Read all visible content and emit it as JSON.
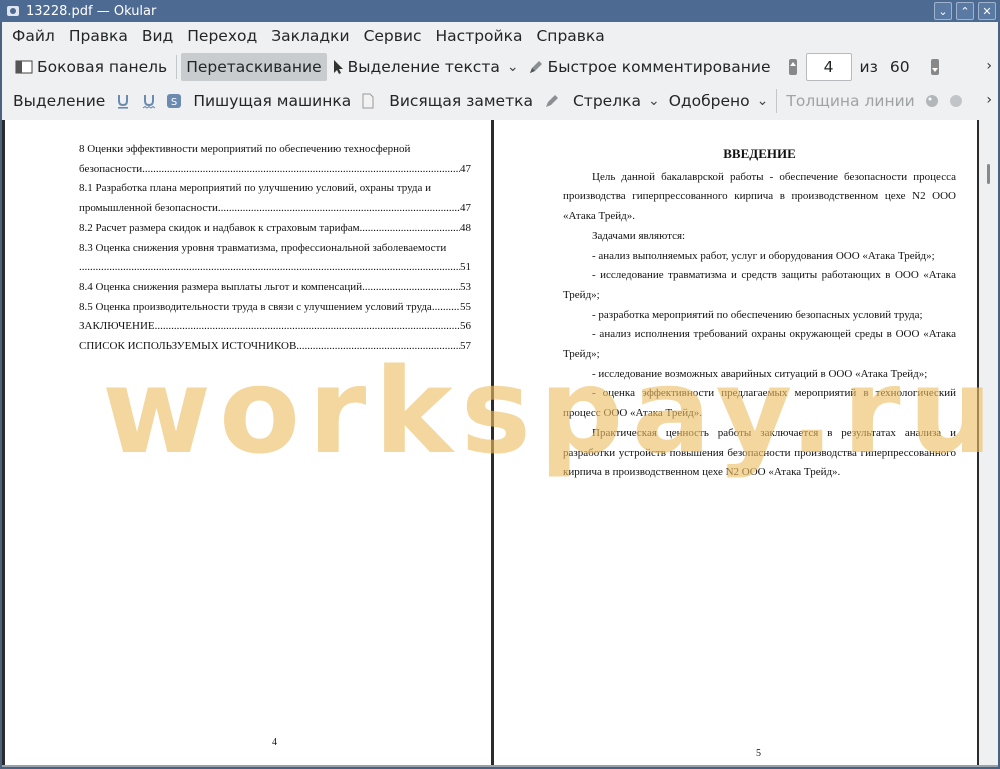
{
  "window": {
    "title": "13228.pdf — Okular",
    "controls": {
      "minimize": "⌄",
      "maximize": "⌃",
      "close": "✕"
    }
  },
  "menu": [
    "Файл",
    "Правка",
    "Вид",
    "Переход",
    "Закладки",
    "Сервис",
    "Настройка",
    "Справка"
  ],
  "toolbar1": {
    "sidebar_label": "Боковая панель",
    "drag_label": "Перетаскивание",
    "text_select_label": "Выделение текста",
    "quick_comment_label": "Быстрое комментирование",
    "page_current": "4",
    "page_of": "из",
    "page_total": "60"
  },
  "toolbar2": {
    "highlight_label": "Выделение",
    "typewriter_label": "Пишущая машинка",
    "popup_note_label": "Висящая заметка",
    "arrow_label": "Стрелка",
    "stamp_label": "Одобрено",
    "line_width_label": "Толщина линии"
  },
  "left_page": {
    "toc": [
      {
        "text": "8 Оценки эффективности мероприятий по обеспечению техносферной",
        "num": ""
      },
      {
        "text": "безопасности",
        "num": "47"
      },
      {
        "text": "8.1 Разработка плана мероприятий по улучшению условий, охраны труда и",
        "num": ""
      },
      {
        "text": "промышленной безопасности",
        "num": "47"
      },
      {
        "text": "8.2 Расчет размера скидок и надбавок к страховым тарифам",
        "num": "48"
      },
      {
        "text": "8.3 Оценка снижения уровня травматизма, профессиональной заболеваемости",
        "num": ""
      },
      {
        "text": "",
        "num": "51"
      },
      {
        "text": "8.4 Оценка снижения размера выплаты льгот и компенсаций",
        "num": "53"
      },
      {
        "text": "8.5 Оценка производительности труда в связи с улучшением условий труда",
        "num": "55"
      },
      {
        "text": "ЗАКЛЮЧЕНИЕ",
        "num": "56"
      },
      {
        "text": "СПИСОК ИСПОЛЬЗУЕМЫХ ИСТОЧНИКОВ",
        "num": "57"
      }
    ],
    "page_number": "4"
  },
  "right_page": {
    "heading": "ВВЕДЕНИЕ",
    "paragraphs": [
      "Цель данной бакалаврской работы - обеспечение безопасности процесса производства гиперпрессованного кирпича в производственном цехе N2 ООО «Атака Трейд».",
      "Задачами являются:",
      "- анализ выполняемых работ, услуг и оборудования ООО «Атака Трейд»;",
      "- исследование травматизма и средств защиты работающих в ООО «Атака Трейд»;",
      "- разработка мероприятий по обеспечению безопасных условий труда;",
      "- анализ исполнения требований охраны окружающей среды в ООО «Атака Трейд»;",
      "- исследование возможных аварийных ситуаций в ООО «Атака Трейд»;",
      "- оценка эффективности предлагаемых мероприятий в технологический процесс ООО «Атака Трейд».",
      "Практическая ценность работы заключается в результатах анализа и разработки устройств повышения безопасности производства гиперпрессованного кирпича в производственном цехе N2 ООО «Атака Трейд»."
    ],
    "page_number": "5"
  },
  "watermark": "workspay.ru",
  "colors": {
    "titlebar": "#4c6a92",
    "chrome": "#eff0f1",
    "watermark": "#ecbe64"
  }
}
